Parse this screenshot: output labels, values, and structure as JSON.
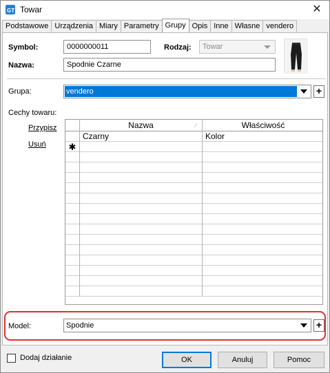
{
  "window": {
    "title": "Towar",
    "icon": "app-logo-icon",
    "close_icon": "close-icon"
  },
  "tabs": [
    {
      "label": "Podstawowe"
    },
    {
      "label": "Urządzenia"
    },
    {
      "label": "Miary"
    },
    {
      "label": "Parametry"
    },
    {
      "label": "Grupy",
      "active": true
    },
    {
      "label": "Opis"
    },
    {
      "label": "Inne"
    },
    {
      "label": "Własne"
    },
    {
      "label": "vendero"
    }
  ],
  "header": {
    "symbol_label": "Symbol:",
    "symbol_value": "0000000011",
    "rodzaj_label": "Rodzaj:",
    "rodzaj_value": "Towar",
    "nazwa_label": "Nazwa:",
    "nazwa_value": "Spodnie Czarne",
    "product_image": "product-thumbnail"
  },
  "grupa": {
    "label": "Grupa:",
    "value": "vendero",
    "plus": "+"
  },
  "cechy": {
    "label": "Cechy towaru:",
    "add_link": "Przypisz",
    "remove_link": "Usuń",
    "columns": [
      "Nazwa",
      "Właściwość"
    ],
    "rows": [
      {
        "nazwa": "Czarny",
        "wlasciwosc": "Kolor"
      }
    ],
    "new_row_marker": "✱"
  },
  "model": {
    "label": "Model:",
    "value": "Spodnie",
    "plus": "+"
  },
  "footer": {
    "checkbox_label": "Dodaj działanie",
    "checkbox_checked": false,
    "ok_label": "OK",
    "cancel_label": "Anuluj",
    "help_label": "Pomoc"
  },
  "colors": {
    "selection": "#0078d7",
    "highlight": "#e03030"
  }
}
